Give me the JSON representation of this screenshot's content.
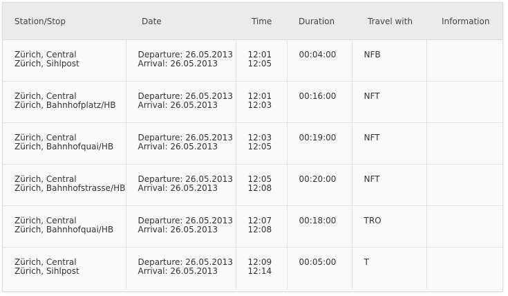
{
  "table": {
    "headers": [
      "Station/Stop",
      "Date",
      "Time",
      "Duration",
      "Travel with",
      "Information"
    ],
    "rows": [
      {
        "from": "Zürich, Central",
        "to": "Zürich, Sihlpost",
        "departure": "Departure: 26.05.2013",
        "arrival": "Arrival: 26.05.2013",
        "dep_time": "12:01",
        "arr_time": "12:05",
        "duration": "00:04:00",
        "travel_with": "NFB",
        "information": ""
      },
      {
        "from": "Zürich, Central",
        "to": "Zürich, Bahnhofplatz/HB",
        "departure": "Departure: 26.05.2013",
        "arrival": "Arrival: 26.05.2013",
        "dep_time": "12:01",
        "arr_time": "12:03",
        "duration": "00:16:00",
        "travel_with": "NFT",
        "information": ""
      },
      {
        "from": "Zürich, Central",
        "to": "Zürich, Bahnhofquai/HB",
        "departure": "Departure: 26.05.2013",
        "arrival": "Arrival: 26.05.2013",
        "dep_time": "12:03",
        "arr_time": "12:05",
        "duration": "00:19:00",
        "travel_with": "NFT",
        "information": ""
      },
      {
        "from": "Zürich, Central",
        "to": "Zürich, Bahnhofstrasse/HB",
        "departure": "Departure: 26.05.2013",
        "arrival": "Arrival: 26.05.2013",
        "dep_time": "12:05",
        "arr_time": "12:08",
        "duration": "00:20:00",
        "travel_with": "NFT",
        "information": ""
      },
      {
        "from": "Zürich, Central",
        "to": "Zürich, Bahnhofquai/HB",
        "departure": "Departure: 26.05.2013",
        "arrival": "Arrival: 26.05.2013",
        "dep_time": "12:07",
        "arr_time": "12:08",
        "duration": "00:18:00",
        "travel_with": "TRO",
        "information": ""
      },
      {
        "from": "Zürich, Central",
        "to": "Zürich, Sihlpost",
        "departure": "Departure: 26.05.2013",
        "arrival": "Arrival: 26.05.2013",
        "dep_time": "12:09",
        "arr_time": "12:14",
        "duration": "00:05:00",
        "travel_with": "T",
        "information": ""
      }
    ]
  }
}
